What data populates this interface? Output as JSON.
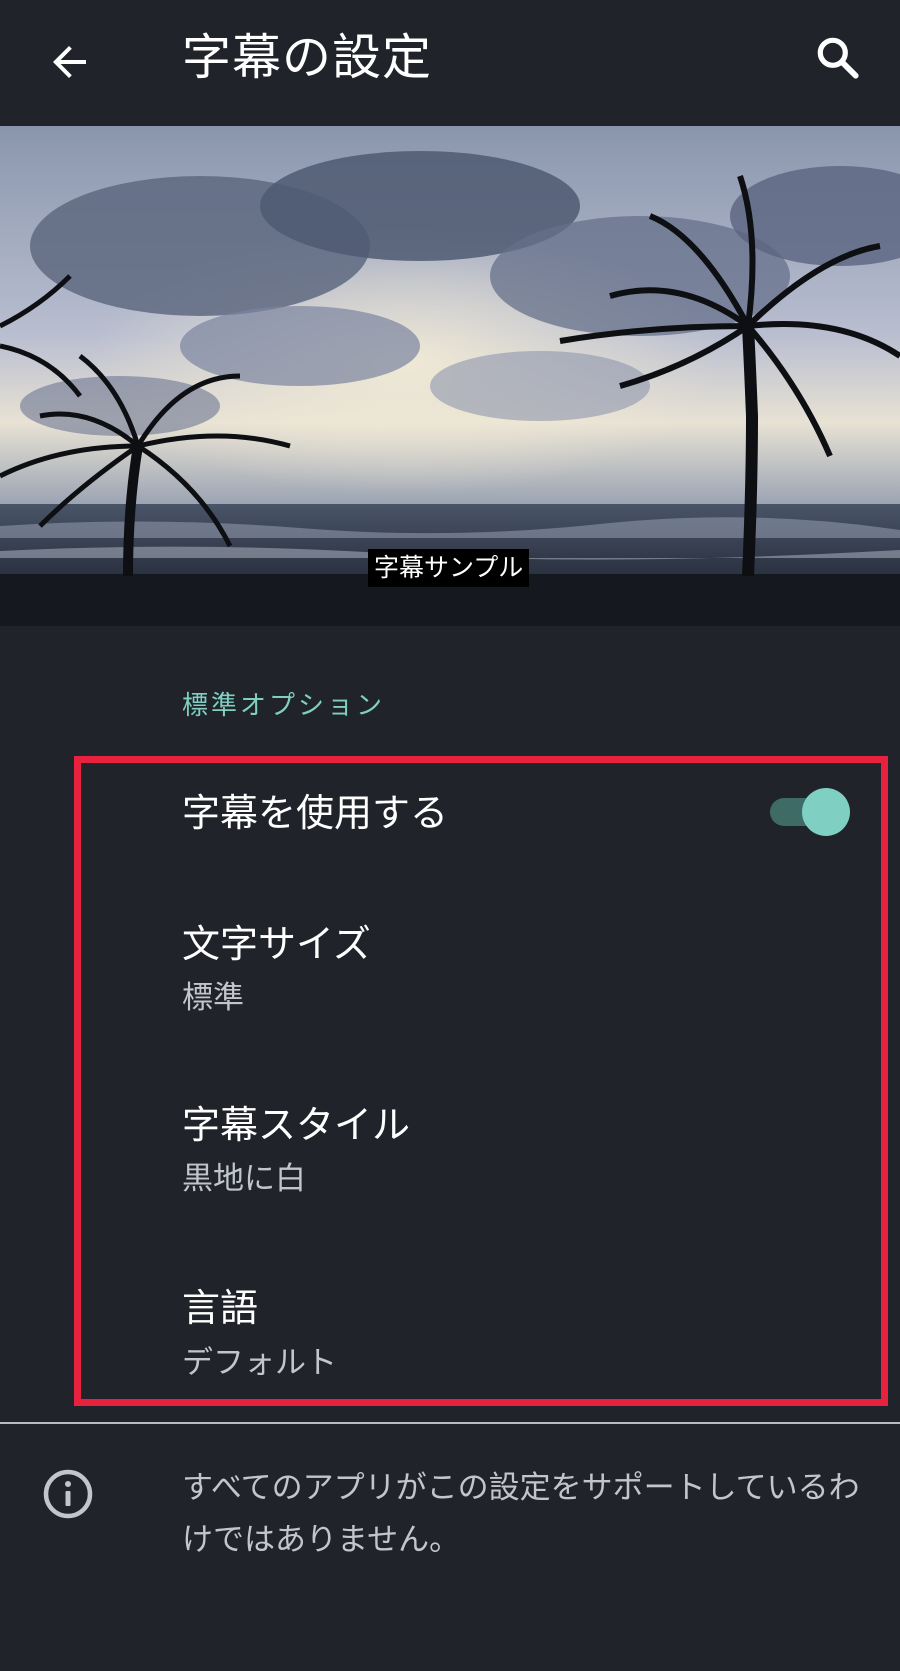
{
  "app_bar": {
    "title": "字幕の設定",
    "back_icon": "arrow-back-icon",
    "search_icon": "search-icon"
  },
  "preview": {
    "caption_sample": "字幕サンプル",
    "image_description_icon": "beach-palm-sunset-image"
  },
  "section": {
    "header": "標準オプション"
  },
  "preferences": {
    "use_captions": {
      "title": "字幕を使用する",
      "enabled": true
    },
    "text_size": {
      "title": "文字サイズ",
      "value": "標準"
    },
    "caption_style": {
      "title": "字幕スタイル",
      "value": "黒地に白"
    },
    "language": {
      "title": "言語",
      "value": "デフォルト"
    }
  },
  "footer": {
    "info_icon": "info-icon",
    "info_text": "すべてのアプリがこの設定をサポートしているわけではありません。"
  },
  "colors": {
    "background": "#20242a",
    "accent": "#7fcfc3",
    "highlight": "#e8213f",
    "summary_text": "#c2c6cc"
  }
}
